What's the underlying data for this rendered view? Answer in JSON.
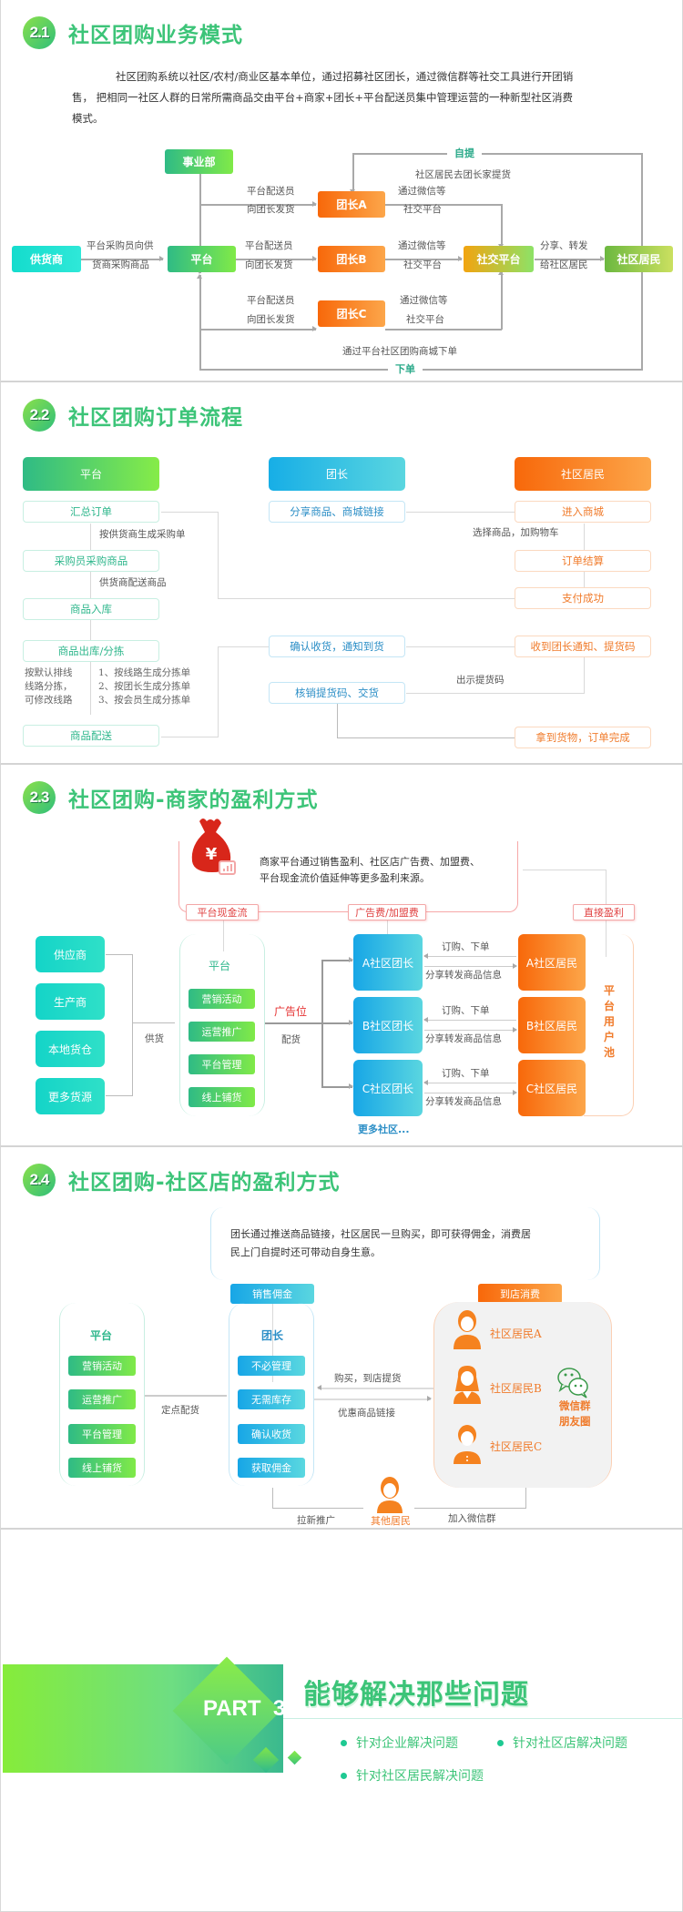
{
  "s21": {
    "num": "2.1",
    "title": "社区团购业务模式",
    "para_line1": "社区团购系统以社区/农村/商业区基本单位，通过招募社区团长，通过微信群等社交工具进行开团销",
    "para_line2": "售，  把相同一社区人群的日常所需商品交由平台+商家+团长+平台配送员集中管理运营的一种新型社区消费",
    "para_line3": "模式。",
    "nodes": {
      "dept": "事业部",
      "supplier": "供货商",
      "platform": "平台",
      "leaderA": "团长A",
      "leaderB": "团长B",
      "leaderC": "团长C",
      "social": "社交平台",
      "resident": "社区居民"
    },
    "labels": {
      "self_pickup": "自提",
      "self_pickup_desc": "社区居民去团长家提货",
      "buy1": "平台采购员向供",
      "buy2": "货商采购商品",
      "ship1": "平台配送员",
      "ship2": "向团长发货",
      "via1": "通过微信等",
      "via2": "社交平台",
      "share1": "分享、转发",
      "share2": "给社区居民",
      "order_desc": "通过平台社区团购商城下单",
      "order": "下单"
    }
  },
  "s22": {
    "num": "2.2",
    "title": "社区团购订单流程",
    "col_platform": "平台",
    "col_leader": "团长",
    "col_resident": "社区居民",
    "platform_steps": [
      "汇总订单",
      "采购员采购商品",
      "商品入库",
      "商品出库/分拣",
      "商品配送"
    ],
    "platform_notes": [
      "按供货商生成采购单",
      "供货商配送商品"
    ],
    "sort_left": [
      "按默认排线",
      "线路分拣，",
      "可修改线路"
    ],
    "sort_right": [
      "1、按线路生成分拣单",
      "2、按团长生成分拣单",
      "3、按会员生成分拣单"
    ],
    "leader_steps": [
      "分享商品、商城链接",
      "确认收货，通知到货",
      "核销提货码、交货"
    ],
    "resident_steps": [
      "进入商城",
      "订单结算",
      "支付成功",
      "收到团长通知、提货码",
      "拿到货物，订单完成"
    ],
    "resident_notes": [
      "选择商品，加购物车",
      "出示提货码"
    ]
  },
  "s23": {
    "num": "2.3",
    "title": "社区团购-商家的盈利方式",
    "summary_line1": "商家平台通过销售盈利、社区店广告费、加盟费、",
    "summary_line2": "平台现金流价值延伸等更多盈利来源。",
    "tags": [
      "平台现金流",
      "广告费/加盟费",
      "直接盈利"
    ],
    "sources": [
      "供应商",
      "生产商",
      "本地货仓",
      "更多货源"
    ],
    "supply": "供货",
    "platform": "平台",
    "platform_items": [
      "营销活动",
      "运营推广",
      "平台管理",
      "线上铺货"
    ],
    "ad_slot": "广告位",
    "distribute": "配货",
    "leaders": [
      "A社区团长",
      "B社区团长",
      "C社区团长"
    ],
    "residents": [
      "A社区居民",
      "B社区居民",
      "C社区居民"
    ],
    "order": "订购、下单",
    "share": "分享转发商品信息",
    "more": "更多社区...",
    "pool": [
      "平",
      "台",
      "用",
      "户",
      "池"
    ]
  },
  "s24": {
    "num": "2.4",
    "title": "社区团购-社区店的盈利方式",
    "summary_line1": "团长通过推送商品链接，社区居民一旦购买，即可获得佣金，消费居",
    "summary_line2": "民上门自提时还可带动自身生意。",
    "tag_commission": "销售佣金",
    "tag_store": "到店消费",
    "platform": "平台",
    "platform_items": [
      "营销活动",
      "运营推广",
      "平台管理",
      "线上铺货"
    ],
    "fixed": "定点配货",
    "leader": "团长",
    "leader_items": [
      "不必管理",
      "无需库存",
      "确认收货",
      "获取佣金"
    ],
    "buy": "购买，到店提货",
    "link": "优惠商品链接",
    "residents": [
      "社区居民A",
      "社区居民B",
      "社区居民C"
    ],
    "wechat1": "微信群",
    "wechat2": "朋友圈",
    "promote": "拉新推广",
    "others": "其他居民",
    "join": "加入微信群"
  },
  "part3": {
    "part": "PART  3",
    "title": "能够解决那些问题",
    "bullets": [
      "针对企业解决问题",
      "针对社区店解决问题",
      "针对社区居民解决问题"
    ]
  }
}
